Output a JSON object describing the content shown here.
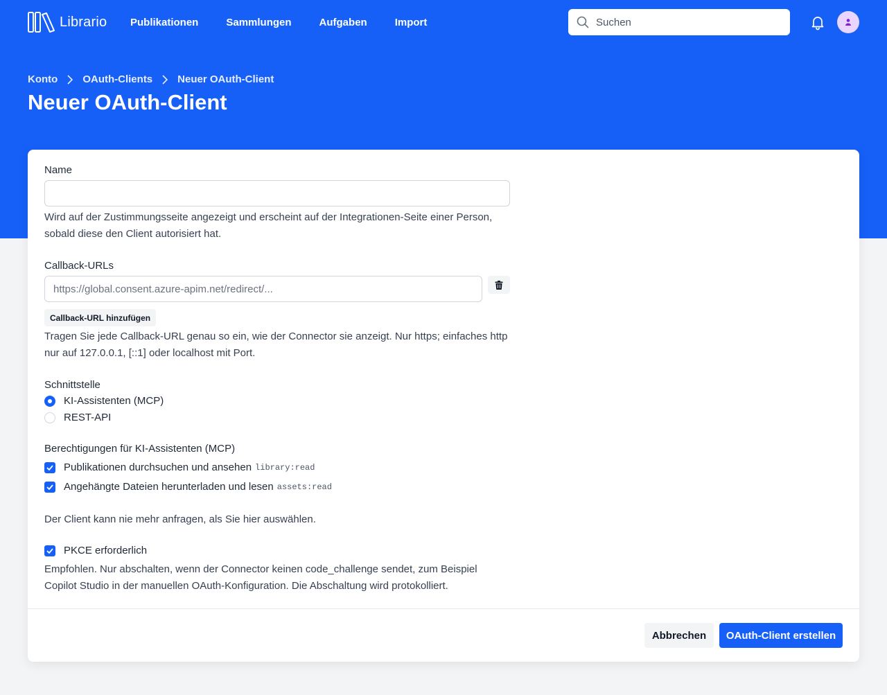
{
  "app": {
    "name": "Librario"
  },
  "nav": {
    "links": [
      "Publikationen",
      "Sammlungen",
      "Aufgaben",
      "Import"
    ],
    "search_placeholder": "Suchen"
  },
  "breadcrumb": [
    "Konto",
    "OAuth-Clients",
    "Neuer OAuth-Client"
  ],
  "page_title": "Neuer OAuth-Client",
  "form": {
    "name": {
      "label": "Name",
      "value": "",
      "help": "Wird auf der Zustimmungsseite angezeigt und erscheint auf der Integrationen-Seite einer Person, sobald diese den Client autorisiert hat."
    },
    "callbacks": {
      "label": "Callback-URLs",
      "placeholder": "https://global.consent.azure-apim.net/redirect/...",
      "value": "",
      "add_label": "Callback-URL hinzufügen",
      "help": "Tragen Sie jede Callback-URL genau so ein, wie der Connector sie anzeigt. Nur https; einfaches http nur auf 127.0.0.1, [::1] oder localhost mit Port."
    },
    "interface": {
      "label": "Schnittstelle",
      "options": [
        {
          "label": "KI-Assistenten (MCP)",
          "selected": true
        },
        {
          "label": "REST-API",
          "selected": false
        }
      ]
    },
    "permissions": {
      "label": "Berechtigungen für KI-Assistenten (MCP)",
      "items": [
        {
          "label": "Publikationen durchsuchen und ansehen",
          "scope": "library:read",
          "checked": true
        },
        {
          "label": "Angehängte Dateien herunterladen und lesen",
          "scope": "assets:read",
          "checked": true
        }
      ],
      "help": "Der Client kann nie mehr anfragen, als Sie hier auswählen."
    },
    "pkce": {
      "label": "PKCE erforderlich",
      "checked": true,
      "help": "Empfohlen. Nur abschalten, wenn der Connector keinen code_challenge sendet, zum Beispiel Copilot Studio in der manuellen OAuth-Konfiguration. Die Abschaltung wird protokolliert."
    }
  },
  "actions": {
    "cancel": "Abbrechen",
    "submit": "OAuth-Client erstellen"
  },
  "colors": {
    "primary": "#1660f8",
    "background": "#f3f4f6",
    "avatar": "#e9d5ff"
  },
  "icons": [
    "librario-logo-icon",
    "search-icon",
    "bell-icon",
    "user-icon",
    "chevron-right-icon",
    "trash-icon",
    "checkmark-icon"
  ]
}
